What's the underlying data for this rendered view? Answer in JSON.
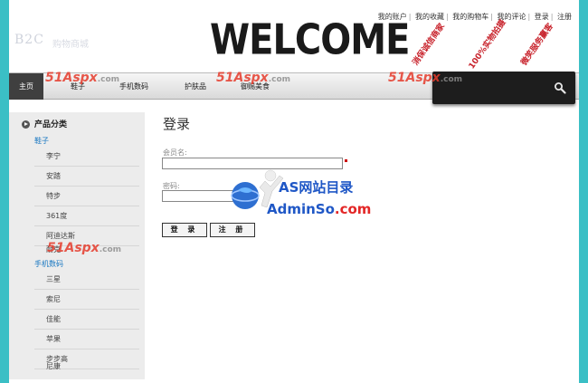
{
  "header": {
    "logo_text": "B2C",
    "logo_sub": "购物商城",
    "welcome": "WELCOME",
    "top_links": [
      "我的账户",
      "我的收藏",
      "我的购物车",
      "我的评论",
      "登录",
      "注册"
    ],
    "stamps": [
      "消保诚信商家",
      "100%实物拍摄",
      "微笑服务赢客"
    ]
  },
  "nav": {
    "items": [
      "主页",
      "鞋子",
      "手机数码",
      "护肤品",
      "御赐美食"
    ],
    "search_placeholder": ""
  },
  "sidebar": {
    "title": "产品分类",
    "groups": [
      {
        "label": "鞋子",
        "items": [
          "李宁",
          "安踏",
          "特步",
          "361度",
          "阿迪达斯",
          "耐克"
        ]
      },
      {
        "label": "手机数码",
        "items": [
          "三星",
          "索尼",
          "佳能",
          "苹果",
          "步步高",
          "尼康"
        ]
      }
    ]
  },
  "login": {
    "title": "登录",
    "username_label": "会员名:",
    "password_label": "密码:",
    "login_button": "登 录",
    "register_button": "注 册"
  },
  "watermarks": {
    "site_a": "51Aspx",
    "site_a_domain": ".com",
    "adminso_cn": "AS网站目录",
    "adminso_en_1": "AdminSo",
    "adminso_en_2": ".com"
  },
  "colors": {
    "background": "#3bbfc5",
    "nav_active": "#3f3f3f",
    "link_blue": "#1a78c2",
    "stamp_red": "#c8232c"
  }
}
